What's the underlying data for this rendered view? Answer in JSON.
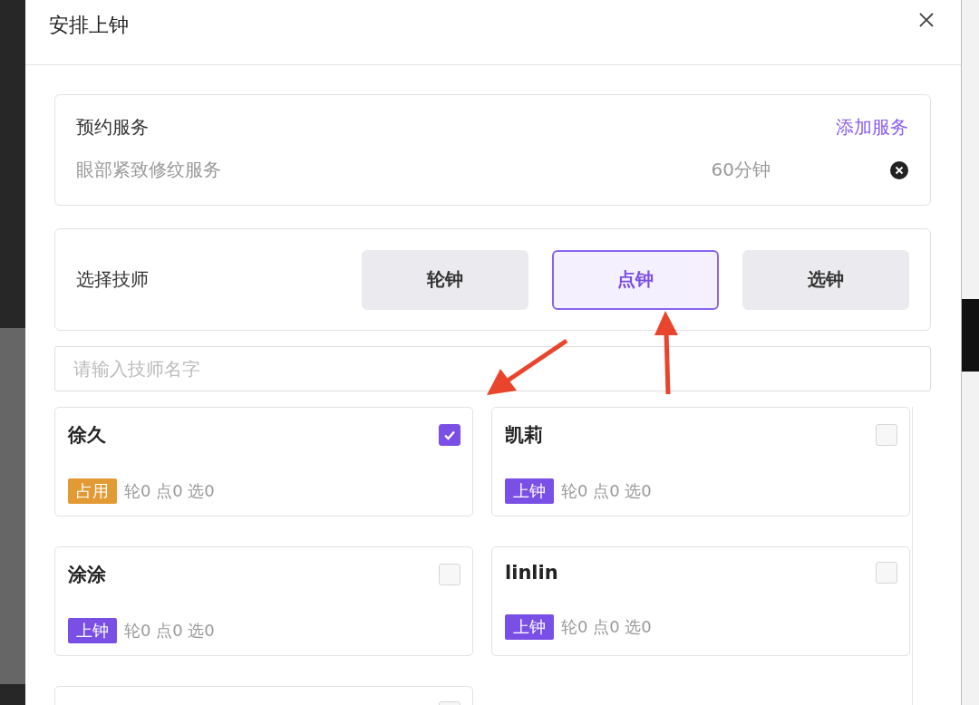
{
  "dialog": {
    "title": "安排上钟"
  },
  "service": {
    "heading": "预约服务",
    "add_link": "添加服务",
    "items": [
      {
        "name": "眼部紧致修纹服务",
        "duration": "60分钟"
      }
    ]
  },
  "technician_mode": {
    "label": "选择技师",
    "options": [
      {
        "label": "轮钟",
        "selected": false
      },
      {
        "label": "点钟",
        "selected": true
      },
      {
        "label": "选钟",
        "selected": false
      }
    ]
  },
  "search": {
    "placeholder": "请输入技师名字"
  },
  "technicians": [
    {
      "name": "徐久",
      "checked": true,
      "status": "占用",
      "color": "#e29a35",
      "stats": "轮0 点0 选0"
    },
    {
      "name": "凯莉",
      "checked": false,
      "status": "上钟",
      "color": "#7a4fe6",
      "stats": "轮0 点0 选0"
    },
    {
      "name": "涂涂",
      "checked": false,
      "status": "上钟",
      "color": "#7a4fe6",
      "stats": "轮0 点0 选0"
    },
    {
      "name": "linlin",
      "checked": false,
      "status": "上钟",
      "color": "#7a4fe6",
      "stats": "轮0 点0 选0"
    },
    {
      "checked": false
    }
  ]
}
